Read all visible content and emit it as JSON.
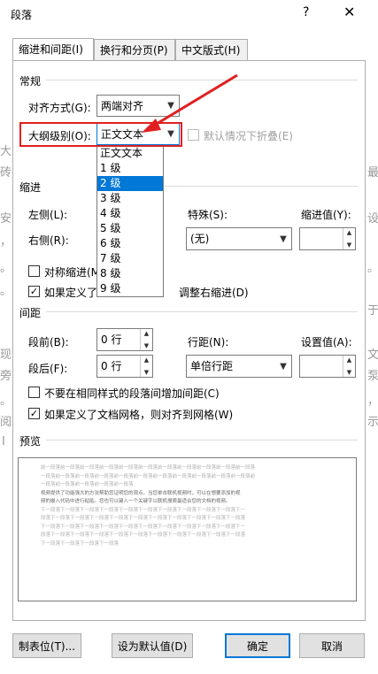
{
  "window": {
    "title": "段落",
    "help": "?",
    "close": "✕"
  },
  "tabs": [
    {
      "label": "缩进和间距(I)",
      "active": true
    },
    {
      "label": "换行和分页(P)",
      "active": false
    },
    {
      "label": "中文版式(H)",
      "active": false
    }
  ],
  "general": {
    "section": "常规",
    "alignment_label": "对齐方式(G):",
    "alignment_value": "两端对齐",
    "outline_label": "大纲级别(O):",
    "outline_value": "正文文本",
    "collapse_label": "默认情况下折叠(E)"
  },
  "outline_dropdown": {
    "options": [
      "正文文本",
      "1 级",
      "2 级",
      "3 级",
      "4 级",
      "5 级",
      "6 级",
      "7 级",
      "8 级",
      "9 级"
    ],
    "selected_index": 2
  },
  "indent": {
    "section": "缩进",
    "left_label": "左侧(L):",
    "right_label": "右侧(R):",
    "special_label": "特殊(S):",
    "special_value": "(无)",
    "indent_value_label": "缩进值(Y):",
    "mirror_label": "对称缩进(M)",
    "auto_adjust_label_prefix": "如果定义了",
    "auto_adjust_label_suffix": "调整右缩进(D)"
  },
  "spacing": {
    "section": "间距",
    "before_label": "段前(B):",
    "before_value": "0 行",
    "after_label": "段后(F):",
    "after_value": "0 行",
    "line_spacing_label": "行距(N):",
    "line_spacing_value": "单倍行距",
    "set_value_label": "设置值(A):",
    "no_space_same_style": "不要在相同样式的段落间增加间距(C)",
    "snap_to_grid": "如果定义了文档网格，则对齐到网格(W)"
  },
  "preview": {
    "section": "预览",
    "lines": [
      "前一段落前一段落前一段落前一段落前一段落前一段落前一段落前一段落前一段落前一段落前一段落",
      "一段落前一段落前一段落前一段落前一段落前一段落前一段落前一段落前一段落前一段落前一段落前",
      "一段落前一段落前一段落前一段落前一段落",
      "视频提供了功能强大的方法帮助您证明您的观点。当您单击联机视频时，可以在想要添加的视",
      "频的嵌入代码中进行粘贴。您也可以键入一个关键字以联机搜索最适合您的文档的视频。",
      "下一段落下一段落下一段落下一段落下一段落下一段落下一段落下一段落下一段落下一段落下一",
      "段落下一段落下一段落下一段落下一段落下一段落下一段落下一段落下一段落下一段落下一段落",
      "下一段落下一段落下一段落下一段落下一段落下一段落下一段落下一段落下一段落下一段落下一",
      "段落下一段落下一段落下一段落下一段落下一段落下一段落下一段落下一段落下一段落下一段落",
      "下一段落下一段落下一段落下一段落"
    ]
  },
  "buttons": {
    "tabs": "制表位(T)...",
    "set_default": "设为默认值(D)",
    "ok": "确定",
    "cancel": "取消"
  },
  "background_text": [
    "大",
    "砖",
    "安",
    "，",
    "。",
    "。",
    "现",
    "旁",
    "。",
    "阅",
    "I",
    "最",
    "设",
    "于",
    "文",
    "泵",
    "，",
    "。",
    "示"
  ],
  "colors": {
    "annotation_red": "#e02020",
    "selection_blue": "#0078d7"
  }
}
